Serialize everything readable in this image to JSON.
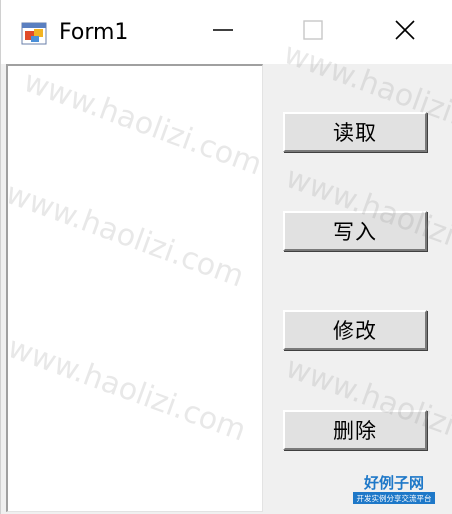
{
  "window": {
    "title": "Form1",
    "icon": "form-app-icon"
  },
  "titlebar_controls": {
    "minimize_icon": "minimize-icon",
    "maximize_icon": "maximize-icon",
    "close_icon": "close-icon"
  },
  "listbox": {
    "items": []
  },
  "buttons": {
    "read_label": "读取",
    "write_label": "写入",
    "edit_label": "修改",
    "delete_label": "删除"
  },
  "watermark": {
    "text": "www.haolizi.com"
  },
  "logo": {
    "title": "好例子网",
    "subtitle": "开发实例分享交流平台"
  },
  "colors": {
    "window_bg": "#f0f0f0",
    "titlebar_bg": "#ffffff",
    "button_face": "#e1e1e1",
    "logo_blue": "#1e78c8"
  }
}
